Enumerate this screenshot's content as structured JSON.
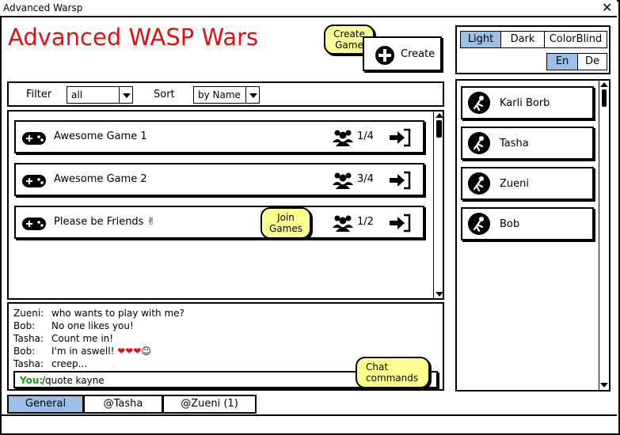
{
  "window": {
    "title": "Advanced Warsp",
    "close_glyph": "✕"
  },
  "app_title": "Advanced WASP Wars",
  "notes": {
    "create_game": "Create Game",
    "join_games": "Join Games",
    "chat_commands": "Chat commands"
  },
  "create_button": {
    "label": "Create",
    "icon": "plus-circle-icon"
  },
  "theme": {
    "options": [
      {
        "label": "Light",
        "selected": true
      },
      {
        "label": "Dark",
        "selected": false
      },
      {
        "label": "ColorBlind",
        "selected": false
      }
    ]
  },
  "language": {
    "options": [
      {
        "label": "En",
        "selected": true
      },
      {
        "label": "De",
        "selected": false
      }
    ]
  },
  "filter": {
    "label": "Filter",
    "value": "all"
  },
  "sort": {
    "label": "Sort",
    "value": "by Name"
  },
  "games": [
    {
      "name": "Awesome Game 1",
      "players": "1/4"
    },
    {
      "name": "Awesome Game 2",
      "players": "3/4"
    },
    {
      "name": "Please be Friends ✌",
      "players": "1/2"
    }
  ],
  "chat": {
    "messages": [
      {
        "author": "Zueni:",
        "text": "who wants to play with me?"
      },
      {
        "author": "Bob:",
        "text": "No one likes you!"
      },
      {
        "author": "Tasha:",
        "text": "Count me in!"
      },
      {
        "author": "Bob:",
        "text": "I'm in aswell! ❤❤❤☺"
      },
      {
        "author": "Tasha:",
        "text": "creep..."
      }
    ],
    "input_label": "You:",
    "input_value": "/quote kayne"
  },
  "chat_tabs": [
    {
      "label": "General",
      "selected": true
    },
    {
      "label": "@Tasha",
      "selected": false
    },
    {
      "label": "@Zueni (1)",
      "selected": false
    }
  ],
  "users": [
    {
      "name": "Karli Borb"
    },
    {
      "name": "Tasha"
    },
    {
      "name": "Zueni"
    },
    {
      "name": "Bob"
    }
  ],
  "colors": {
    "title": "#e01010",
    "selected": "#9cbfe8",
    "note": "#ffff90",
    "you": "#1a9a1a"
  }
}
